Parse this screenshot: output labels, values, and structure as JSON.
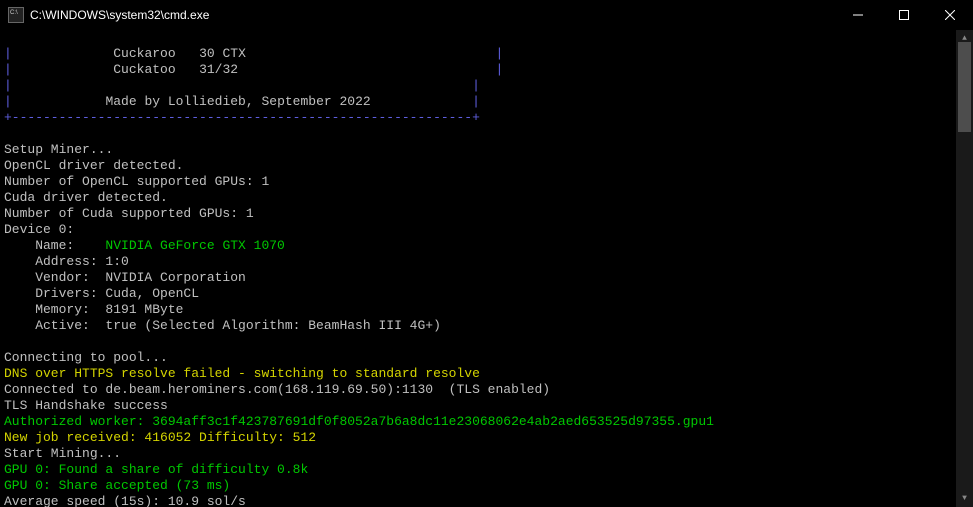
{
  "titlebar": {
    "title": "C:\\WINDOWS\\system32\\cmd.exe"
  },
  "banner": {
    "line1_left": "|",
    "line1_right": "|",
    "cuckaroo_label": "Cuckaroo",
    "cuckaroo_val": "30 CTX",
    "cuckatoo_label": "Cuckatoo",
    "cuckatoo_val": "31/32",
    "credits": "Made by Lolliedieb, September 2022",
    "dashline": "+-----------------------------------------------------------+"
  },
  "setup": {
    "l1": "Setup Miner...",
    "l2": "OpenCL driver detected.",
    "l3": "Number of OpenCL supported GPUs: 1",
    "l4": "Cuda driver detected.",
    "l5": "Number of Cuda supported GPUs: 1",
    "l6": "Device 0:"
  },
  "device": {
    "name_label": "    Name:    ",
    "name_value": "NVIDIA GeForce GTX 1070",
    "address": "    Address: 1:0",
    "vendor": "    Vendor:  NVIDIA Corporation",
    "drivers": "    Drivers: Cuda, OpenCL",
    "memory": "    Memory:  8191 MByte",
    "active": "    Active:  true (Selected Algorithm: BeamHash III 4G+)"
  },
  "pool": {
    "connecting": "Connecting to pool...",
    "dns_fail": "DNS over HTTPS resolve failed - switching to standard resolve",
    "connected": "Connected to de.beam.herominers.com(168.119.69.50):1130  (TLS enabled)",
    "tls_ok": "TLS Handshake success",
    "authorized": "Authorized worker: 3694aff3c1f423787691df0f8052a7b6a8dc11e23068062e4ab2aed653525d97355.gpu1",
    "newjob": "New job received: 416052 Difficulty: 512",
    "start": "Start Mining...",
    "share_found": "GPU 0: Found a share of difficulty 0.8k",
    "share_accepted": "GPU 0: Share accepted (73 ms)",
    "avg_speed": "Average speed (15s): 10.9 sol/s"
  }
}
